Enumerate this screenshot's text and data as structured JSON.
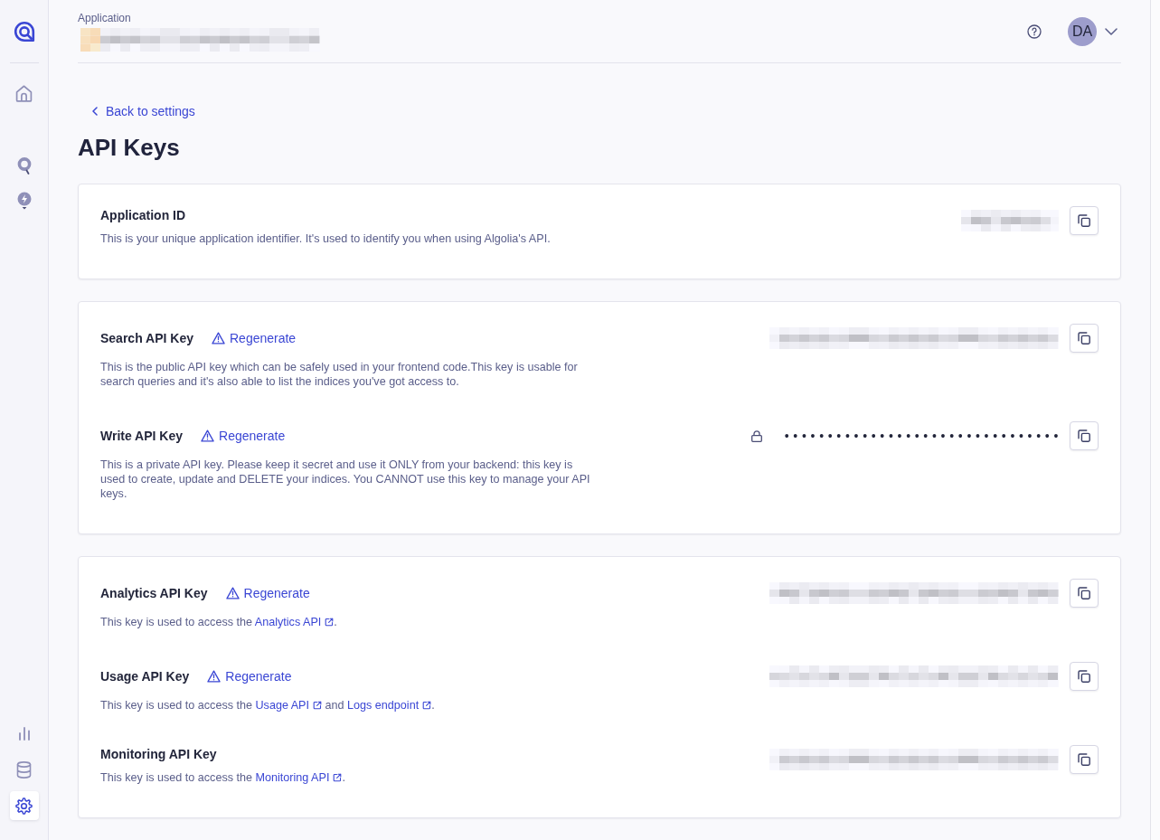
{
  "sidebar": {
    "groups": [
      {
        "items": [
          {
            "kind": "home",
            "selected": false
          }
        ]
      },
      {
        "items": [
          {
            "kind": "search",
            "selected": false
          },
          {
            "kind": "bolt",
            "selected": false
          }
        ]
      },
      {
        "items": [
          {
            "kind": "chart",
            "selected": false
          },
          {
            "kind": "database",
            "selected": false
          },
          {
            "kind": "settings",
            "selected": true
          }
        ]
      }
    ]
  },
  "header": {
    "label": "Application",
    "user": {
      "initials": "DA"
    }
  },
  "back_link": "Back to settings",
  "title": "API Keys",
  "cards": [
    {
      "keys": [
        {
          "title": "Application ID",
          "description": [
            {
              "kind": "text",
              "text": "This is your unique application identifier. It's used to identify you when using Algolia's API."
            }
          ],
          "value": {
            "kind": "redacted"
          }
        }
      ]
    },
    {
      "keys": [
        {
          "title": "Search API Key",
          "regenerate": "Regenerate",
          "description": [
            {
              "kind": "text",
              "text": "This is the public API key which can be safely used in your frontend code.This key is usable for search queries and it's also able to list the indices you've got access to."
            }
          ],
          "value": {
            "kind": "redacted"
          }
        },
        {
          "title": "Write API Key",
          "regenerate": "Regenerate",
          "description": [
            {
              "kind": "text",
              "text": "This is a private API key. Please keep it secret and use it ONLY from your backend: this key is used to create, update and DELETE your indices. You CANNOT use this key to manage your API keys."
            }
          ],
          "value": {
            "kind": "hidden",
            "text": "••••••••••••••••••••••••••••••••"
          }
        }
      ]
    },
    {
      "keys": [
        {
          "title": "Analytics API Key",
          "regenerate": "Regenerate",
          "description": [
            {
              "kind": "text",
              "text": "This key is used to access the "
            },
            {
              "kind": "link",
              "text": "Analytics API"
            },
            {
              "kind": "text",
              "text": "."
            }
          ],
          "value": {
            "kind": "redacted"
          }
        },
        {
          "title": "Usage API Key",
          "regenerate": "Regenerate",
          "description": [
            {
              "kind": "text",
              "text": "This key is used to access the "
            },
            {
              "kind": "link",
              "text": "Usage API"
            },
            {
              "kind": "text",
              "text": " and "
            },
            {
              "kind": "link",
              "text": "Logs endpoint"
            },
            {
              "kind": "text",
              "text": "."
            }
          ],
          "value": {
            "kind": "redacted"
          }
        },
        {
          "title": "Monitoring API Key",
          "description": [
            {
              "kind": "text",
              "text": "This key is used to access the "
            },
            {
              "kind": "link",
              "text": "Monitoring API"
            },
            {
              "kind": "text",
              "text": "."
            }
          ],
          "value": {
            "kind": "redacted"
          }
        }
      ]
    }
  ]
}
